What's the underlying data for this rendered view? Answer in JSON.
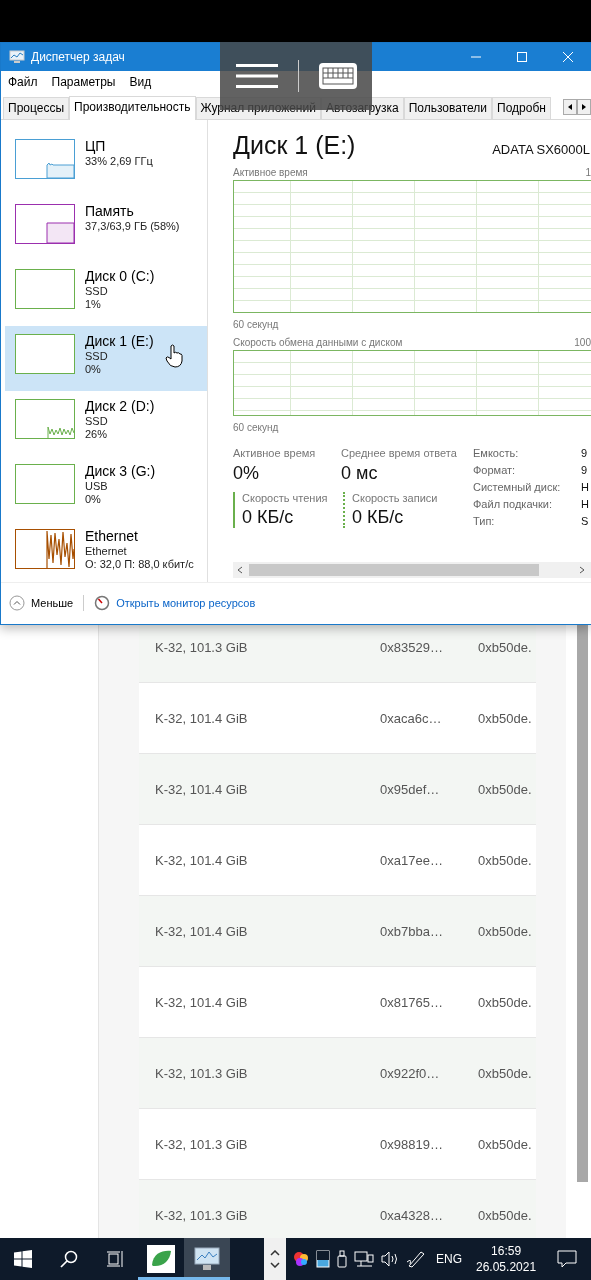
{
  "window": {
    "title": "Диспетчер задач"
  },
  "menu": [
    "Файл",
    "Параметры",
    "Вид"
  ],
  "tabs": [
    {
      "label": "Процессы",
      "selected": false
    },
    {
      "label": "Производительность",
      "selected": true
    },
    {
      "label": "Журнал приложений",
      "selected": false
    },
    {
      "label": "Автозагрузка",
      "selected": false
    },
    {
      "label": "Пользователи",
      "selected": false
    },
    {
      "label": "Подробн",
      "selected": false
    }
  ],
  "sidebar": {
    "items": [
      {
        "kind": "cpu",
        "title": "ЦП",
        "subtitle": "33% 2,69 ГГц",
        "color": "#4a9fd4",
        "selected": false
      },
      {
        "kind": "memory",
        "title": "Память",
        "subtitle": "37,3/63,9 ГБ (58%)",
        "color": "#9b2fae",
        "selected": false
      },
      {
        "kind": "flat",
        "title": "Диск 0 (C:)",
        "subtitle": "SSD",
        "detail": "1%",
        "color": "#6ab04c",
        "selected": false
      },
      {
        "kind": "flat",
        "title": "Диск 1 (E:)",
        "subtitle": "SSD",
        "detail": "0%",
        "color": "#6ab04c",
        "selected": true
      },
      {
        "kind": "noise",
        "title": "Диск 2 (D:)",
        "subtitle": "SSD",
        "detail": "26%",
        "color": "#6ab04c",
        "selected": false
      },
      {
        "kind": "flat",
        "title": "Диск 3 (G:)",
        "subtitle": "USB",
        "detail": "0%",
        "color": "#6ab04c",
        "selected": false
      },
      {
        "kind": "spikes",
        "title": "Ethernet",
        "subtitle": "Ethernet",
        "detail": "О: 32,0 П: 88,0 кбит/с",
        "color": "#a74f01",
        "selected": false
      }
    ]
  },
  "panel": {
    "title": "Диск 1 (E:)",
    "model": "ADATA SX6000L",
    "chart_1": {
      "label": "Активное время",
      "max": "1",
      "time": "60 секунд"
    },
    "chart_2": {
      "label": "Скорость обмена данными с диском",
      "max": "100",
      "time": "60 секунд"
    },
    "stats": [
      {
        "label": "Активное время",
        "value": "0%"
      },
      {
        "label": "Среднее время ответа",
        "value": "0 мс"
      }
    ],
    "rates": [
      {
        "kind": "solid",
        "label": "Скорость чтения",
        "value": "0 КБ/с"
      },
      {
        "kind": "dotted",
        "label": "Скорость записи",
        "value": "0 КБ/с"
      }
    ],
    "details": [
      {
        "label": "Емкость:",
        "value": "9"
      },
      {
        "label": "Формат:",
        "value": "9"
      },
      {
        "label": "Системный диск:",
        "value": "Н"
      },
      {
        "label": "Файл подкачки:",
        "value": "Н"
      },
      {
        "label": "Тип:",
        "value": "S"
      }
    ]
  },
  "footer": {
    "less": "Меньше",
    "link": "Открыть монитор ресурсов"
  },
  "table": {
    "rows": [
      {
        "column_1": "K-32, 101.3 GiB",
        "column_2": "0x83529…",
        "column_3": "0xb50de."
      },
      {
        "column_1": "K-32, 101.4 GiB",
        "column_2": "0xaca6c…",
        "column_3": "0xb50de."
      },
      {
        "column_1": "K-32, 101.4 GiB",
        "column_2": "0x95def…",
        "column_3": "0xb50de."
      },
      {
        "column_1": "K-32, 101.4 GiB",
        "column_2": "0xa17ee…",
        "column_3": "0xb50de."
      },
      {
        "column_1": "K-32, 101.4 GiB",
        "column_2": "0xb7bba…",
        "column_3": "0xb50de."
      },
      {
        "column_1": "K-32, 101.4 GiB",
        "column_2": "0x81765…",
        "column_3": "0xb50de."
      },
      {
        "column_1": "K-32, 101.3 GiB",
        "column_2": "0x922f0…",
        "column_3": "0xb50de."
      },
      {
        "column_1": "K-32, 101.3 GiB",
        "column_2": "0x98819…",
        "column_3": "0xb50de."
      },
      {
        "column_1": "K-32, 101.3 GiB",
        "column_2": "0xa4328…",
        "column_3": "0xb50de."
      }
    ]
  },
  "taskbar": {
    "apps": [
      {
        "kind": "leaf",
        "selected": false
      },
      {
        "kind": "monitor",
        "selected": true
      }
    ],
    "language": "ENG",
    "time": "16:59",
    "date": "26.05.2021"
  }
}
